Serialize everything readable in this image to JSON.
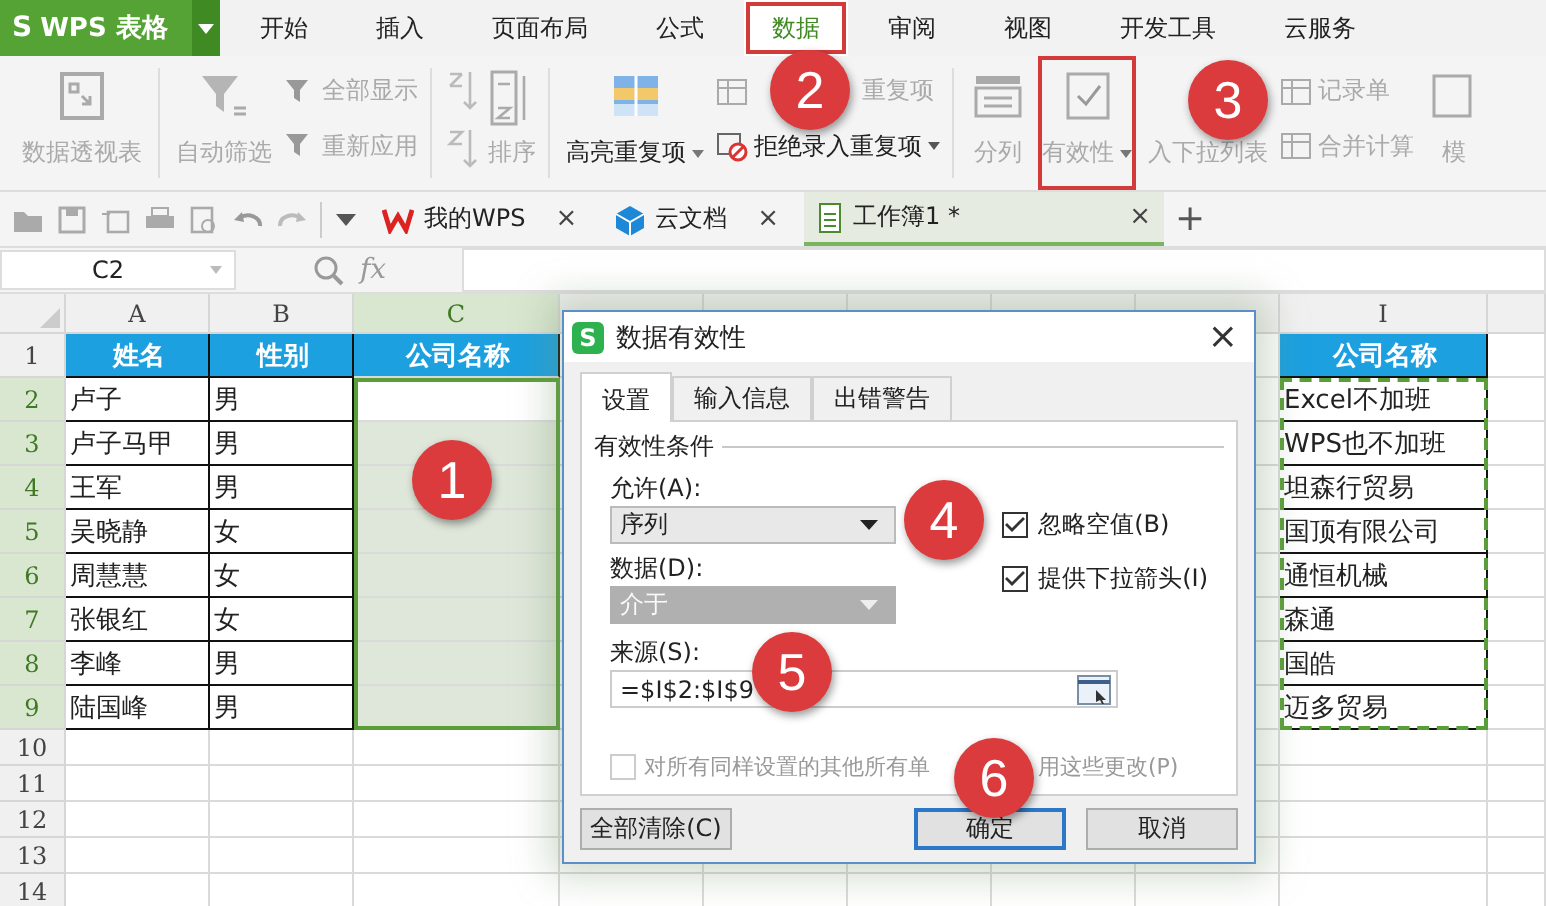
{
  "app_button": {
    "logo": "S",
    "label": "WPS 表格"
  },
  "menu_tabs": [
    {
      "label": "开始",
      "selected": false,
      "highlighted": false
    },
    {
      "label": "插入",
      "selected": false,
      "highlighted": false
    },
    {
      "label": "页面布局",
      "selected": false,
      "highlighted": false
    },
    {
      "label": "公式",
      "selected": false,
      "highlighted": false
    },
    {
      "label": "数据",
      "selected": true,
      "highlighted": true
    },
    {
      "label": "审阅",
      "selected": false,
      "highlighted": false
    },
    {
      "label": "视图",
      "selected": false,
      "highlighted": false
    },
    {
      "label": "开发工具",
      "selected": false,
      "highlighted": false
    },
    {
      "label": "云服务",
      "selected": false,
      "highlighted": false
    }
  ],
  "ribbon_groups": [
    [
      {
        "kind": "large",
        "label": "数据透视表",
        "disabled": true,
        "dropdown": false,
        "highlighted": false
      }
    ],
    [
      {
        "kind": "large",
        "label": "自动筛选",
        "disabled": true,
        "dropdown": false,
        "highlighted": false
      },
      {
        "kind": "stack",
        "items": [
          {
            "label": "全部显示",
            "disabled": true,
            "dropdown": false
          },
          {
            "label": "重新应用",
            "disabled": true,
            "dropdown": false
          }
        ]
      }
    ],
    [
      {
        "kind": "sort",
        "label": "排序",
        "disabled": true
      }
    ],
    [
      {
        "kind": "large",
        "label": "高亮重复项",
        "disabled": false,
        "dropdown": true,
        "highlighted": false
      },
      {
        "kind": "stack",
        "items": [
          {
            "label": "重复项",
            "disabled": true,
            "dropdown": false
          },
          {
            "label": "拒绝录入重复项",
            "disabled": false,
            "dropdown": true
          }
        ]
      }
    ],
    [
      {
        "kind": "large",
        "label": "分列",
        "disabled": true,
        "dropdown": false,
        "highlighted": false
      },
      {
        "kind": "large",
        "label": "有效性",
        "disabled": true,
        "dropdown": true,
        "highlighted": true
      },
      {
        "kind": "large",
        "label": "入下拉列表",
        "disabled": true,
        "dropdown": false,
        "highlighted": false
      },
      {
        "kind": "stack",
        "items": [
          {
            "label": "记录单",
            "disabled": true,
            "dropdown": false
          },
          {
            "label": "合并计算",
            "disabled": true,
            "dropdown": false
          }
        ]
      },
      {
        "kind": "large",
        "label": "模",
        "disabled": true,
        "dropdown": false,
        "highlighted": false
      }
    ]
  ],
  "doc_tabs": [
    {
      "label": "我的WPS",
      "selected": false,
      "close": "×"
    },
    {
      "label": "云文档",
      "selected": false,
      "close": "×"
    },
    {
      "label": "工作簿1 *",
      "selected": true,
      "close": "×"
    }
  ],
  "new_tab": "+",
  "formula_bar": {
    "cell_ref": "C2",
    "fx": "fx"
  },
  "grid": {
    "columns": [
      {
        "label": "A",
        "selected": false
      },
      {
        "label": "B",
        "selected": false
      },
      {
        "label": "C",
        "selected": true
      },
      {},
      {},
      {},
      {},
      {},
      {
        "label": "I",
        "selected": false
      }
    ],
    "rows": [
      {
        "number": "1",
        "selected": false,
        "kind": "header",
        "A": "姓名",
        "B": "性别",
        "C": "公司名称",
        "I": "公司名称"
      },
      {
        "number": "2",
        "selected": true,
        "A": "卢子",
        "B": "男",
        "I": "Excel不加班"
      },
      {
        "number": "3",
        "selected": true,
        "A": "卢子马甲",
        "B": "男",
        "I": "WPS也不加班"
      },
      {
        "number": "4",
        "selected": true,
        "A": "王军",
        "B": "男",
        "I": "坦森行贸易"
      },
      {
        "number": "5",
        "selected": true,
        "A": "吴晓静",
        "B": "女",
        "I": "国顶有限公司"
      },
      {
        "number": "6",
        "selected": true,
        "A": "周慧慧",
        "B": "女",
        "I": "通恒机械"
      },
      {
        "number": "7",
        "selected": true,
        "A": "张银红",
        "B": "女",
        "I": "森通"
      },
      {
        "number": "8",
        "selected": true,
        "A": "李峰",
        "B": "男",
        "I": "国皓"
      },
      {
        "number": "9",
        "selected": true,
        "A": "陆国峰",
        "B": "男",
        "I": "迈多贸易"
      },
      {
        "number": "10",
        "selected": false
      },
      {
        "number": "11",
        "selected": false
      },
      {
        "number": "12",
        "selected": false
      },
      {
        "number": "13",
        "selected": false
      },
      {
        "number": "14",
        "selected": false
      }
    ],
    "copy_marquee": true
  },
  "dialog": {
    "logo": "S",
    "title": "数据有效性",
    "close": "×",
    "tabs": [
      {
        "label": "设置",
        "selected": true
      },
      {
        "label": "输入信息",
        "selected": false
      },
      {
        "label": "出错警告",
        "selected": false
      }
    ],
    "group_label": "有效性条件",
    "allow": {
      "label": "允许(A):",
      "value": "序列",
      "disabled": false
    },
    "data": {
      "label": "数据(D):",
      "value": "介于",
      "disabled": true
    },
    "options": [
      {
        "label": "忽略空值(B)",
        "checked": true
      },
      {
        "label": "提供下拉箭头(I)",
        "checked": true
      }
    ],
    "source": {
      "label": "来源(S):",
      "value": "=$I$2:$I$9"
    },
    "apply_all": {
      "label_parts": [
        "对所有同样设置的其他所有单",
        "用这些更改(P)"
      ],
      "checked": false,
      "disabled": true
    },
    "buttons": [
      {
        "label": "全部清除(C)",
        "default": false
      },
      {
        "label": "确定",
        "default": true
      },
      {
        "label": "取消",
        "default": false
      }
    ]
  },
  "annotations": [
    {
      "number": "1"
    },
    {
      "number": "2"
    },
    {
      "number": "3"
    },
    {
      "number": "4"
    },
    {
      "number": "5"
    },
    {
      "number": "6"
    }
  ]
}
